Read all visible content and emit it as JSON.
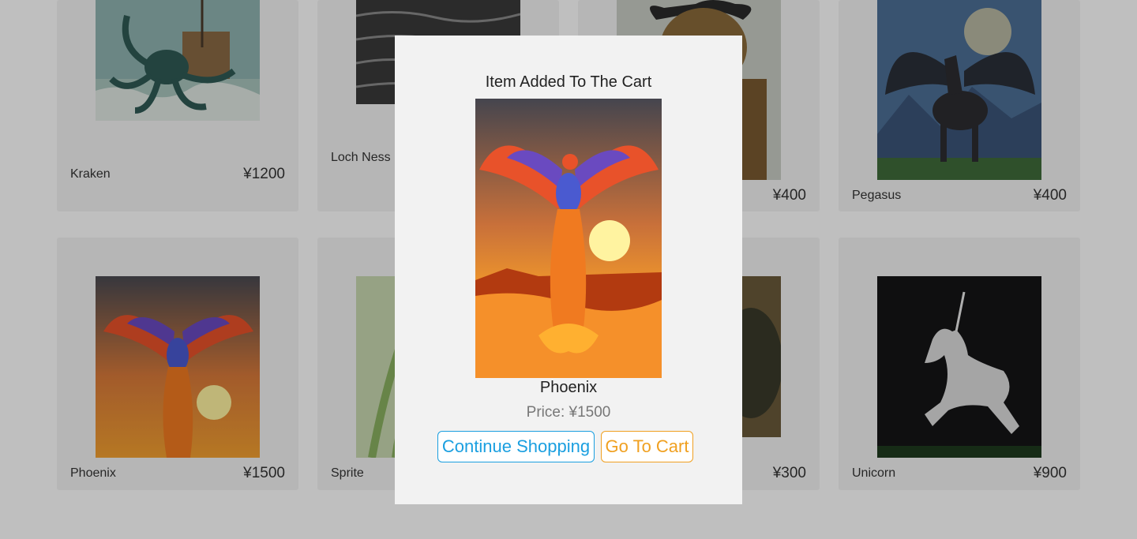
{
  "products": [
    {
      "name": "Kraken",
      "price": "¥1200"
    },
    {
      "name": "Loch Ness",
      "price": ""
    },
    {
      "name": "",
      "price": "¥400"
    },
    {
      "name": "Pegasus",
      "price": "¥400"
    },
    {
      "name": "Phoenix",
      "price": "¥1500"
    },
    {
      "name": "Sprite",
      "price": ""
    },
    {
      "name": "",
      "price": "¥300"
    },
    {
      "name": "Unicorn",
      "price": "¥900"
    }
  ],
  "modal": {
    "title": "Item Added To The Cart",
    "product_name": "Phoenix",
    "price_text": "Price: ¥1500",
    "continue_label": "Continue Shopping",
    "cart_label": "Go To Cart"
  },
  "colors": {
    "continue": "#1a9fe0",
    "cart": "#f0a020",
    "overlay": "rgba(0,0,0,0.25)"
  }
}
